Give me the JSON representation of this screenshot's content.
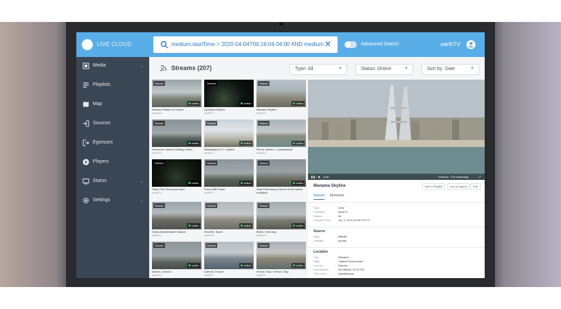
{
  "app": {
    "title": "LIVE CLOUD",
    "user": "earthTV"
  },
  "search": {
    "query": "medium.startTime > 2020-04-04T06:16:04-04:00 AND medium",
    "clear": "✕"
  },
  "advanced": {
    "label": "Advanced Search",
    "enabled": false
  },
  "sidebar": {
    "items": [
      {
        "label": "Media",
        "icon": "media-icon",
        "expandable": true
      },
      {
        "label": "Playlists",
        "icon": "playlist-icon",
        "expandable": false
      },
      {
        "label": "Map",
        "icon": "map-icon",
        "expandable": false
      },
      {
        "label": "Sources",
        "icon": "sources-icon",
        "expandable": false
      },
      {
        "label": "Egresses",
        "icon": "egresses-icon",
        "expandable": false
      },
      {
        "label": "Players",
        "icon": "players-icon",
        "expandable": false
      },
      {
        "label": "Status",
        "icon": "status-icon",
        "expandable": true
      },
      {
        "label": "Settings",
        "icon": "settings-icon",
        "expandable": true
      }
    ]
  },
  "streams": {
    "title": "Streams (207)",
    "filters": {
      "type": "Type: All",
      "status": "Status: Online",
      "sort": "Sort by: Date"
    },
    "tag": "Stream",
    "online": "online",
    "cards": [
      {
        "title": "Warsaw Palace of Culture",
        "publisher": "earthTV"
      },
      {
        "title": "Auckland Skyline",
        "publisher": "earthTV"
      },
      {
        "title": "Manama Skyline",
        "publisher": "earthTV"
      },
      {
        "title": "Vancouver Jericho Sailing Centre",
        "publisher": "earthTV"
      },
      {
        "title": "Washington D.C. Capitol",
        "publisher": "earthTV"
      },
      {
        "title": "Rio de Janeiro - Copacabana",
        "publisher": "earthTV"
      },
      {
        "title": "Tokyo The Peninsula Hotel",
        "publisher": "earthTV"
      },
      {
        "title": "Paris Eiffel Tower",
        "publisher": "earthTV"
      },
      {
        "title": "Saint Petersburg Church of the Savior on Blood",
        "publisher": "earthTV"
      },
      {
        "title": "Kotka Amphitheater Katana",
        "publisher": "earthTV"
      },
      {
        "title": "Tenerife, Spain",
        "publisher": "earthTV"
      },
      {
        "title": "Berlin, Germany",
        "publisher": "earthTV"
      },
      {
        "title": "Athens, Greece",
        "publisher": "earthTV"
      },
      {
        "title": "Cannes, France",
        "publisher": "earthTV"
      },
      {
        "title": "Venice, Italy / Venice, Italy",
        "publisher": "earthTV"
      }
    ]
  },
  "detail": {
    "title": "Manama Skyline",
    "buttons": {
      "playlist": "Add to Playlist",
      "egress": "Link to Egress",
      "edit": "Edit"
    },
    "video": {
      "live": "LIVE",
      "preview": "Preview · 27s remaining"
    },
    "tabs": [
      "Stream",
      "Moments"
    ],
    "stream_fields": [
      {
        "k": "Type",
        "v": "none"
      },
      {
        "k": "Publisher",
        "v": "earthTV"
      },
      {
        "k": "Region",
        "v": "de"
      },
      {
        "k": "Creation Time",
        "v": "Jun 3, 2019 14:18 UTC+2"
      }
    ],
    "source": {
      "heading": "Source",
      "fields": [
        {
          "k": "Alias",
          "v": "BRMM"
        },
        {
          "k": "Visibility",
          "v": "private"
        }
      ]
    },
    "location": {
      "heading": "Location",
      "fields": [
        {
          "k": "City",
          "v": "Manama"
        },
        {
          "k": "State",
          "v": "Capital Governorate"
        },
        {
          "k": "Country",
          "v": "Bahrain"
        },
        {
          "k": "Coordinates",
          "v": "26.236665, 50.57732"
        },
        {
          "k": "Time Zone",
          "v": "Asia/Bahrain"
        }
      ]
    }
  }
}
